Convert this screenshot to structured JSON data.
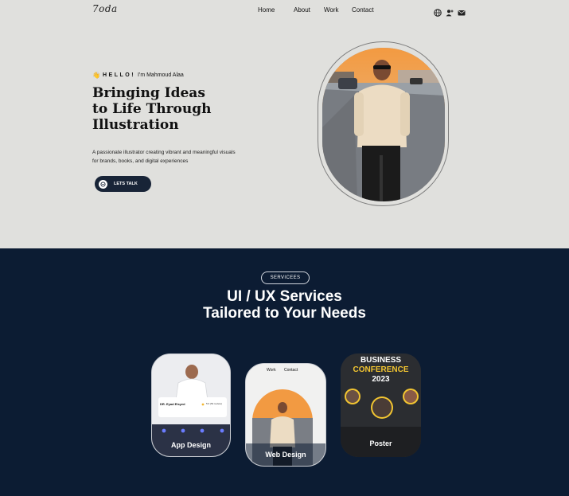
{
  "brand": {
    "logo": "7oda"
  },
  "nav": {
    "items": [
      "Home",
      "About",
      "Work",
      "Contact"
    ]
  },
  "nav_icons": [
    "globe-icon",
    "user-plus-icon",
    "mail-icon"
  ],
  "hero": {
    "hello_prefix": "HELLO!",
    "hello_name": "I'm Mahmoud Alaa",
    "headline": [
      "Bringing Ideas",
      "to Life Through",
      "Illustration"
    ],
    "description": [
      "A passionate illustrator creating vibrant and meaningful visuals",
      "for brands, books, and digital experiences"
    ],
    "cta": "LETS TALK"
  },
  "services": {
    "pill": "SERVICEES",
    "title_line1": "UI / UX Services",
    "title_line2": "Tailored to Your Needs",
    "cards": [
      {
        "label": "App Design",
        "doctor_name": "DR. Eyad Elsyed",
        "rating_text": "5.0 (54 review)"
      },
      {
        "label": "Web Design",
        "mini_nav": [
          "Work",
          "Contact"
        ]
      },
      {
        "label": "Poster",
        "poster_title": [
          "BUSINESS",
          "CONFERENCE",
          "2023"
        ]
      }
    ]
  },
  "colors": {
    "hero_bg": "#e0e0dd",
    "services_bg": "#0c1c33",
    "button_bg": "#182437",
    "poster_accent": "#f2c531"
  }
}
